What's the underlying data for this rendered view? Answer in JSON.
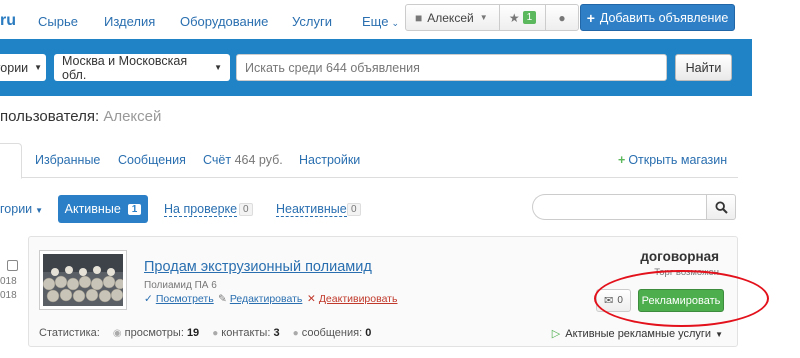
{
  "topnav": {
    "logo_fragment": "ru",
    "links": [
      "Сырье",
      "Изделия",
      "Оборудование",
      "Услуги"
    ],
    "more": "Еще",
    "user": "Алексей",
    "favorites_count": "1",
    "add_button": "Добавить объявление"
  },
  "search": {
    "category_fragment": "гории",
    "region": "Москва и Московская обл.",
    "placeholder": "Искать среди 644 объявления",
    "button": "Найти"
  },
  "page": {
    "title_prefix": "пользователя:",
    "username": "Алексей"
  },
  "tabs": {
    "favorites": "Избранные",
    "messages": "Сообщения",
    "account_label": "Счёт",
    "account_amount": "464 руб.",
    "settings": "Настройки",
    "open_shop": "Открыть магазин"
  },
  "filters": {
    "category_fragment": "гории",
    "active_label": "Активные",
    "active_count": "1",
    "review_label": "На проверке",
    "review_count": "0",
    "inactive_label": "Неактивные",
    "inactive_count": "0"
  },
  "listing": {
    "date_fragment_1": "018",
    "date_fragment_2": "018",
    "title": "Продам экструзионный полиамид",
    "subtitle": "Полиамид ПА 6",
    "actions": {
      "view": "Посмотреть",
      "edit": "Редактировать",
      "deactivate": "Деактивировать"
    },
    "price": "договорная",
    "price_note": "Торг возможен",
    "messages_count": "0",
    "promote_button": "Рекламировать",
    "stats": {
      "label": "Статистика:",
      "views_label": "просмотры:",
      "views": "19",
      "contacts_label": "контакты:",
      "contacts": "3",
      "messages_label": "сообщения:",
      "messages": "0"
    },
    "ad_services": "Активные рекламные услуги"
  },
  "colors": {
    "brand_blue": "#1f83c6",
    "link_blue": "#2a6fb0",
    "green": "#4cae4c",
    "annotation_red": "#e3111b"
  }
}
